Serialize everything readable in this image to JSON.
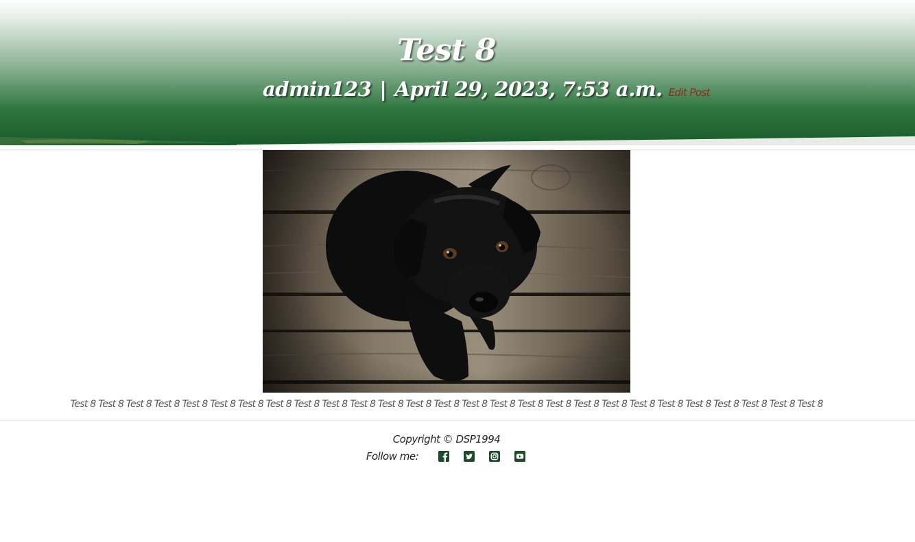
{
  "post": {
    "title": "Test 8",
    "author": "admin123",
    "separator": "|",
    "date": "April 29, 2023, 7:53 a.m.",
    "edit_label": "Edit Post",
    "body": "Test 8 Test 8 Test 8 Test 8 Test 8 Test 8 Test 8 Test 8 Test 8 Test 8 Test 8 Test 8 Test 8 Test 8 Test 8 Test 8 Test 8 Test 8 Test 8 Test 8 Test 8 Test 8 Test 8 Test 8 Test 8 Test 8 Test 8"
  },
  "footer": {
    "copyright": "Copyright © DSP1994",
    "follow_label": "Follow me:",
    "social": [
      "facebook-icon",
      "twitter-icon",
      "instagram-icon",
      "youtube-icon"
    ]
  },
  "colors": {
    "hero_dark_green": "#1b5a2c",
    "icon_green": "#1d4b2a",
    "edit_link": "#8e2a1d"
  }
}
